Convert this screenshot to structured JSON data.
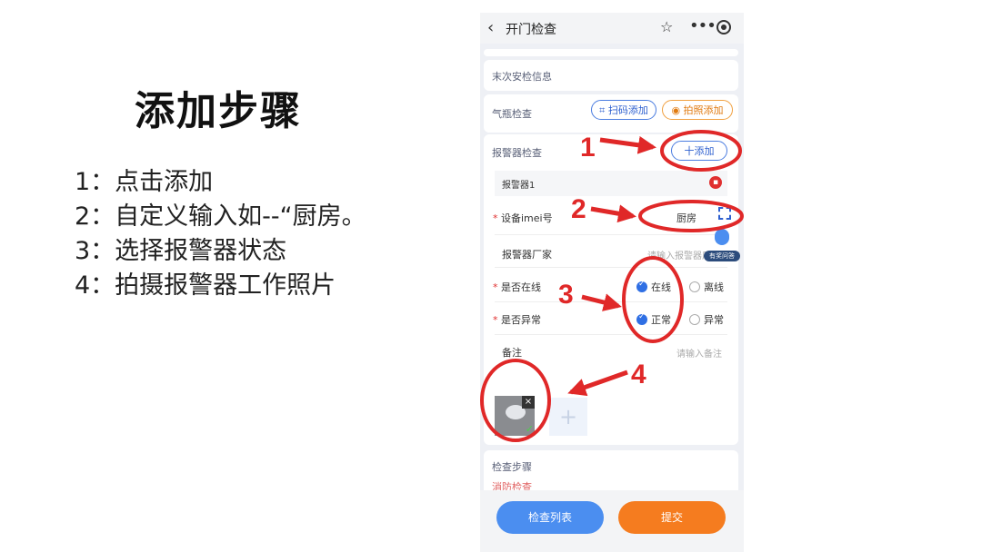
{
  "slide": {
    "title": "添加步骤",
    "steps": [
      "1：点击添加",
      "2：自定义输入如--“厨房。",
      "3：选择报警器状态",
      "4：拍摄报警器工作照片"
    ]
  },
  "app": {
    "title": "开门检查",
    "last_check_label": "末次安检信息",
    "cylinder": {
      "label": "气瓶检查",
      "scan_button": "扫码添加",
      "photo_button": "拍照添加"
    },
    "alarm": {
      "label": "报警器检查",
      "add_button": "十添加",
      "item_title": "报警器1",
      "imei_label": "设备imei号",
      "imei_value": "厨房",
      "maker_label": "报警器厂家",
      "maker_placeholder": "请输入报警器厂家",
      "online_label": "是否在线",
      "online_options": [
        "在线",
        "离线"
      ],
      "abnormal_label": "是否异常",
      "abnormal_options": [
        "正常",
        "异常"
      ],
      "remark_label": "备注",
      "remark_placeholder": "请输入备注"
    },
    "steps_label": "检查步骤",
    "steps_sub": "消防检查",
    "assistant_badge": "有奖问答",
    "bottom": {
      "list_button": "检查列表",
      "submit_button": "提交"
    }
  },
  "annotations": [
    "1",
    "2",
    "3",
    "4"
  ],
  "colors": {
    "accent_blue": "#4b8ef0",
    "accent_orange": "#f57c1f",
    "annotation_red": "#e02828",
    "required_red": "#e03030"
  }
}
